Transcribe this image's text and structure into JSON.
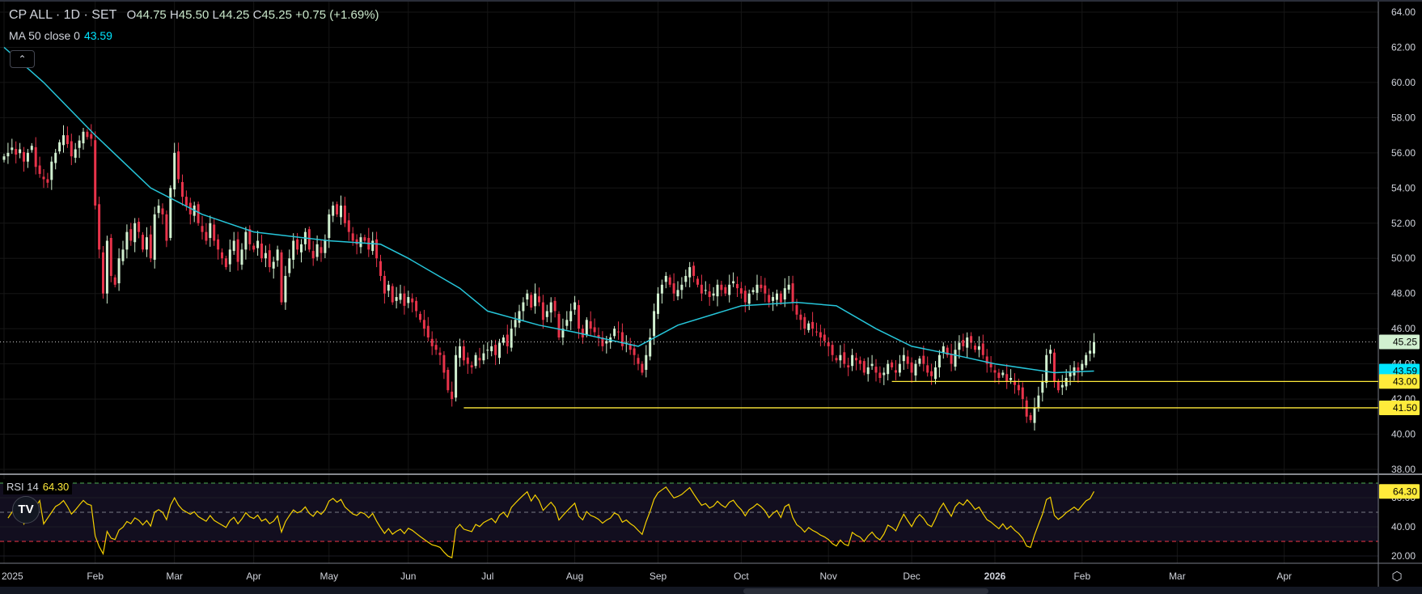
{
  "header": {
    "symbol": "CP ALL · 1D · SET",
    "o_label": "O",
    "o": "44.75",
    "h_label": "H",
    "h": "45.50",
    "l_label": "L",
    "l": "44.25",
    "c_label": "C",
    "c": "45.25",
    "change": "+0.75 (+1.69%)"
  },
  "ma_legend": {
    "label": "MA 50 close 0",
    "value": "43.59"
  },
  "rsi_legend": {
    "label": "RSI 14",
    "value": "64.30"
  },
  "collapse_icon": "chevron-up-icon",
  "logo": "TV",
  "colors": {
    "up": "#d1f0d0",
    "down": "#e8334a",
    "ma": "#26c6da",
    "level": "#ffeb3b",
    "rsi": "#f5d000",
    "bg": "#000000"
  },
  "chart_data": {
    "type": "candlestick",
    "title": "CP ALL · 1D · SET",
    "ylim": [
      38,
      64
    ],
    "y_ticks": [
      "64.00",
      "62.00",
      "60.00",
      "58.00",
      "56.00",
      "54.00",
      "52.00",
      "50.00",
      "48.00",
      "46.00",
      "44.00",
      "42.00",
      "40.00",
      "38.00"
    ],
    "x_ticks": [
      {
        "bar": 0,
        "label": "2025"
      },
      {
        "bar": 23,
        "label": "Feb"
      },
      {
        "bar": 43,
        "label": "Mar"
      },
      {
        "bar": 63,
        "label": "Apr"
      },
      {
        "bar": 82,
        "label": "May"
      },
      {
        "bar": 102,
        "label": "Jun"
      },
      {
        "bar": 122,
        "label": "Jul"
      },
      {
        "bar": 144,
        "label": "Aug"
      },
      {
        "bar": 165,
        "label": "Sep"
      },
      {
        "bar": 186,
        "label": "Oct"
      },
      {
        "bar": 208,
        "label": "Nov"
      },
      {
        "bar": 229,
        "label": "Dec"
      },
      {
        "bar": 250,
        "label": "2026"
      },
      {
        "bar": 272,
        "label": "Feb"
      },
      {
        "bar": 296,
        "label": "Mar"
      },
      {
        "bar": 323,
        "label": "Apr"
      }
    ],
    "closes": [
      55.8,
      56.0,
      56.3,
      55.9,
      56.2,
      55.5,
      56.0,
      56.4,
      55.2,
      54.8,
      54.5,
      54.3,
      55.5,
      56.0,
      56.6,
      57.0,
      56.5,
      55.8,
      56.2,
      56.7,
      57.2,
      56.9,
      56.8,
      53.0,
      50.5,
      48.0,
      51.0,
      49.0,
      48.5,
      50.0,
      50.5,
      51.5,
      51.0,
      52.0,
      51.5,
      50.5,
      51.2,
      50.0,
      52.5,
      53.0,
      52.5,
      51.0,
      54.0,
      56.0,
      54.5,
      53.5,
      53.0,
      52.5,
      53.0,
      52.0,
      51.5,
      51.0,
      52.0,
      51.0,
      50.5,
      50.0,
      49.5,
      50.5,
      51.0,
      49.8,
      50.5,
      51.5,
      50.8,
      50.5,
      51.0,
      50.0,
      50.3,
      49.5,
      49.8,
      50.5,
      47.5,
      49.0,
      50.0,
      51.0,
      50.5,
      50.8,
      51.5,
      50.5,
      50.0,
      50.8,
      50.3,
      51.0,
      52.5,
      53.0,
      52.5,
      53.0,
      52.0,
      51.5,
      51.0,
      50.8,
      51.2,
      51.0,
      50.5,
      51.0,
      50.0,
      49.0,
      48.0,
      48.5,
      47.5,
      47.8,
      48.0,
      47.3,
      47.8,
      47.5,
      47.0,
      46.5,
      46.0,
      45.5,
      45.0,
      44.8,
      44.5,
      43.5,
      42.5,
      42.0,
      44.5,
      45.0,
      44.2,
      44.0,
      43.8,
      44.5,
      44.2,
      44.6,
      44.8,
      45.0,
      44.5,
      45.2,
      45.5,
      45.0,
      46.0,
      46.5,
      47.0,
      47.5,
      48.0,
      47.2,
      48.0,
      47.5,
      46.5,
      47.0,
      47.5,
      47.0,
      45.5,
      46.0,
      46.5,
      47.0,
      47.5,
      46.0,
      45.5,
      46.5,
      46.0,
      45.8,
      45.5,
      45.0,
      45.3,
      45.5,
      46.0,
      45.8,
      45.0,
      45.2,
      44.8,
      44.5,
      44.0,
      43.5,
      44.5,
      45.5,
      47.0,
      48.0,
      48.5,
      49.0,
      48.5,
      48.0,
      48.2,
      48.5,
      49.0,
      49.5,
      49.0,
      48.5,
      48.0,
      48.2,
      47.8,
      48.0,
      48.5,
      48.2,
      48.0,
      48.5,
      48.7,
      48.3,
      48.0,
      47.5,
      48.0,
      48.2,
      48.5,
      48.3,
      48.0,
      47.5,
      47.8,
      48.0,
      47.5,
      48.3,
      48.5,
      47.5,
      46.8,
      46.5,
      46.0,
      46.3,
      46.0,
      45.8,
      45.5,
      45.3,
      45.0,
      44.5,
      44.2,
      44.5,
      44.0,
      43.8,
      44.5,
      44.2,
      44.0,
      43.5,
      43.8,
      44.0,
      43.5,
      43.2,
      43.5,
      44.0,
      43.8,
      43.5,
      44.0,
      44.5,
      44.0,
      43.5,
      44.0,
      44.3,
      44.0,
      43.5,
      43.3,
      43.8,
      44.5,
      45.0,
      44.5,
      44.0,
      44.8,
      45.2,
      45.0,
      45.5,
      45.2,
      44.8,
      45.0,
      44.5,
      44.0,
      43.8,
      43.5,
      43.2,
      43.5,
      43.0,
      43.2,
      42.8,
      42.5,
      42.0,
      41.0,
      40.8,
      41.5,
      42.2,
      43.0,
      44.5,
      44.8,
      43.0,
      42.5,
      42.8,
      43.2,
      43.5,
      43.8,
      43.5,
      44.0,
      44.5,
      44.75,
      45.25
    ],
    "ma50": [
      [
        0,
        62.0
      ],
      [
        10,
        60.0
      ],
      [
        23,
        57.0
      ],
      [
        30,
        55.5
      ],
      [
        37,
        54.0
      ],
      [
        50,
        52.5
      ],
      [
        63,
        51.5
      ],
      [
        82,
        51.0
      ],
      [
        95,
        50.8
      ],
      [
        102,
        50.0
      ],
      [
        115,
        48.3
      ],
      [
        122,
        47.0
      ],
      [
        135,
        46.2
      ],
      [
        144,
        45.8
      ],
      [
        160,
        45.0
      ],
      [
        170,
        46.2
      ],
      [
        186,
        47.3
      ],
      [
        200,
        47.5
      ],
      [
        210,
        47.3
      ],
      [
        220,
        46.0
      ],
      [
        229,
        45.0
      ],
      [
        240,
        44.5
      ],
      [
        250,
        44.0
      ],
      [
        265,
        43.5
      ],
      [
        275,
        43.59
      ]
    ],
    "rsi_period": 14,
    "rsi_ticks": [
      "60.00",
      "40.00",
      "20.00"
    ],
    "rsi_levels": [
      70,
      50,
      30
    ],
    "levels": [
      {
        "price": 43.0,
        "label": "43.00",
        "from_bar": 224
      },
      {
        "price": 41.5,
        "label": "41.50",
        "from_bar": 116
      }
    ],
    "last_price": {
      "value": 45.25,
      "label": "45.25"
    },
    "ma_last": {
      "value": 43.59,
      "label": "43.59"
    },
    "rsi_last": {
      "value": 64.3,
      "label": "64.30"
    }
  }
}
